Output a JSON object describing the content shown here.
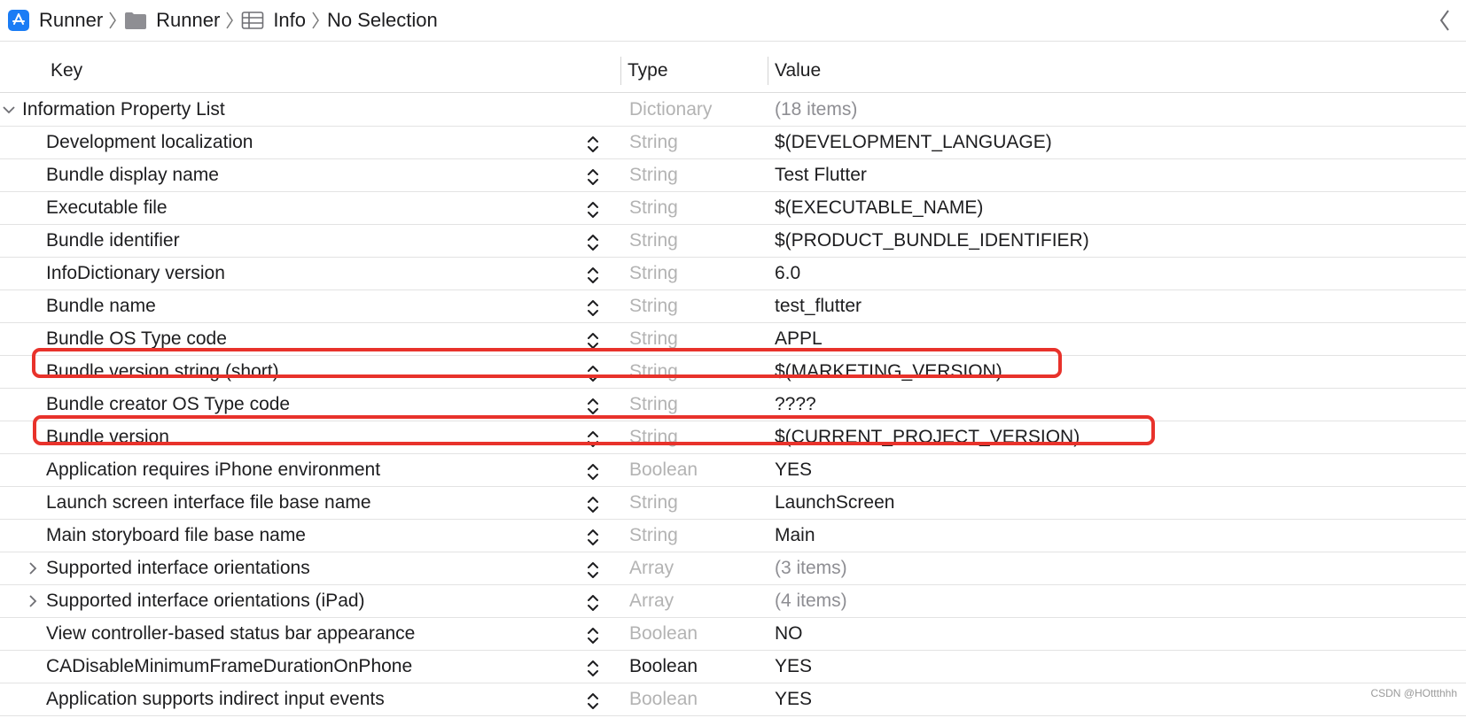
{
  "breadcrumb": {
    "items": [
      {
        "label": "Runner",
        "icon": "app-store-icon"
      },
      {
        "label": "Runner",
        "icon": "folder-icon"
      },
      {
        "label": "Info",
        "icon": "table-icon"
      },
      {
        "label": "No Selection",
        "icon": ""
      }
    ]
  },
  "header": {
    "key": "Key",
    "type": "Type",
    "value": "Value"
  },
  "root": {
    "key": "Information Property List",
    "type": "Dictionary",
    "value": "(18 items)",
    "expanded": true
  },
  "rows": [
    {
      "key": "Development localization",
      "type": "String",
      "value": "$(DEVELOPMENT_LANGUAGE)"
    },
    {
      "key": "Bundle display name",
      "type": "String",
      "value": "Test Flutter"
    },
    {
      "key": "Executable file",
      "type": "String",
      "value": "$(EXECUTABLE_NAME)"
    },
    {
      "key": "Bundle identifier",
      "type": "String",
      "value": "$(PRODUCT_BUNDLE_IDENTIFIER)"
    },
    {
      "key": "InfoDictionary version",
      "type": "String",
      "value": "6.0"
    },
    {
      "key": "Bundle name",
      "type": "String",
      "value": "test_flutter"
    },
    {
      "key": "Bundle OS Type code",
      "type": "String",
      "value": "APPL"
    },
    {
      "key": "Bundle version string (short)",
      "type": "String",
      "value": "$(MARKETING_VERSION)",
      "highlighted": true
    },
    {
      "key": "Bundle creator OS Type code",
      "type": "String",
      "value": "????"
    },
    {
      "key": "Bundle version",
      "type": "String",
      "value": "$(CURRENT_PROJECT_VERSION)",
      "highlighted": true
    },
    {
      "key": "Application requires iPhone environment",
      "type": "Boolean",
      "value": "YES"
    },
    {
      "key": "Launch screen interface file base name",
      "type": "String",
      "value": "LaunchScreen"
    },
    {
      "key": "Main storyboard file base name",
      "type": "String",
      "value": "Main"
    },
    {
      "key": "Supported interface orientations",
      "type": "Array",
      "value": "(3 items)",
      "collapsible": true
    },
    {
      "key": "Supported interface orientations (iPad)",
      "type": "Array",
      "value": "(4 items)",
      "collapsible": true
    },
    {
      "key": "View controller-based status bar appearance",
      "type": "Boolean",
      "value": "NO"
    },
    {
      "key": "CADisableMinimumFrameDurationOnPhone",
      "type": "Boolean",
      "value": "YES",
      "type_dark": true
    },
    {
      "key": "Application supports indirect input events",
      "type": "Boolean",
      "value": "YES"
    }
  ],
  "watermark": "CSDN @HOttthhh",
  "colors": {
    "highlight": "#e8322b",
    "app_icon": "#1a7cf5",
    "folder": "#8e8e93",
    "type_text": "#b3b3b3",
    "value_muted": "#8e8e93"
  }
}
